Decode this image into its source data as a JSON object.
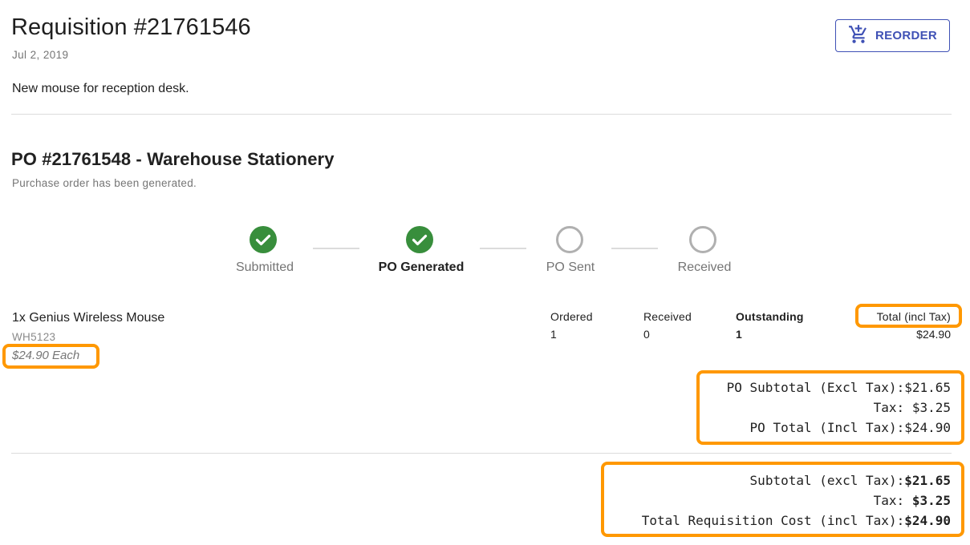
{
  "header": {
    "title": "Requisition #21761546",
    "date": "Jul 2, 2019",
    "description": "New mouse for reception desk.",
    "reorder_label": "REORDER",
    "reorder_icon": "cart-plus-icon"
  },
  "colors": {
    "accent": "#3f51b5",
    "success": "#388e3c",
    "pending": "#bdbdbd",
    "highlight": "#ff9800"
  },
  "po": {
    "title": "PO #21761548 - Warehouse Stationery",
    "status_text": "Purchase order has been generated.",
    "steps": [
      {
        "label": "Submitted",
        "state": "complete",
        "icon": "check-circle-icon"
      },
      {
        "label": "PO Generated",
        "state": "active",
        "icon": "check-circle-icon"
      },
      {
        "label": "PO Sent",
        "state": "pending",
        "icon": "empty-circle-icon"
      },
      {
        "label": "Received",
        "state": "pending",
        "icon": "empty-circle-icon"
      }
    ],
    "columns": [
      "Ordered",
      "Received",
      "Outstanding",
      "Total (incl Tax)"
    ],
    "items": [
      {
        "name": "1x Genius Wireless Mouse",
        "sku": "WH5123",
        "unit_price": "$24.90 Each",
        "ordered": "1",
        "received": "0",
        "outstanding": "1",
        "total": "$24.90"
      }
    ],
    "summary": {
      "subtotal_label": "PO Subtotal (Excl Tax):",
      "subtotal_value": "$21.65",
      "tax_label": "Tax: ",
      "tax_value": "$3.25",
      "total_label": "PO Total (Incl Tax):",
      "total_value": "$24.90"
    }
  },
  "requisition_summary": {
    "subtotal_label": "Subtotal (excl Tax):",
    "subtotal_value": "$21.65",
    "tax_label": "Tax: ",
    "tax_value": "$3.25",
    "total_label": "Total Requisition Cost (incl Tax):",
    "total_value": "$24.90"
  }
}
